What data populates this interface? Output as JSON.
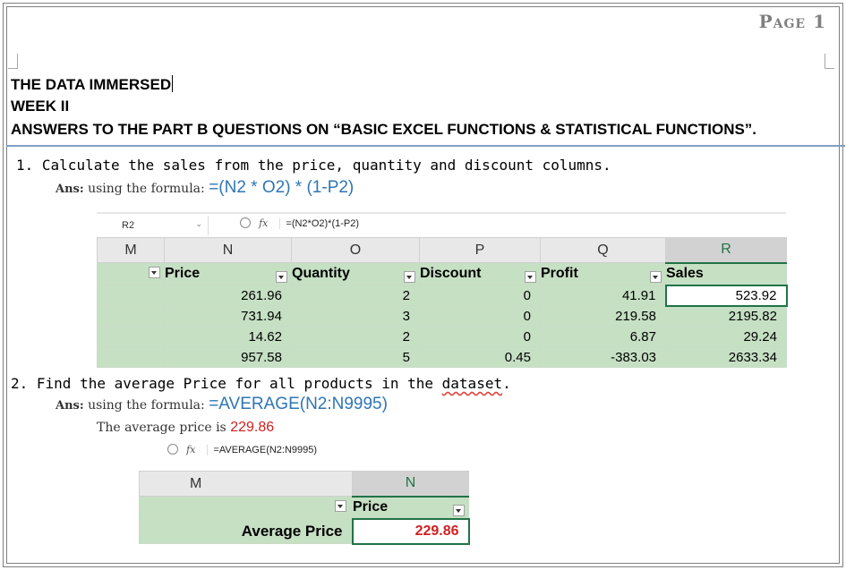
{
  "header": {
    "page_label": "Page 1"
  },
  "title": {
    "line1": "THE DATA IMMERSED",
    "line2": "WEEK II",
    "line3": "ANSWERS TO THE PART B QUESTIONS ON “BASIC EXCEL FUNCTIONS & STATISTICAL FUNCTIONS”."
  },
  "q1": {
    "number": "1.",
    "text": "Calculate the sales from the price, quantity and discount columns.",
    "ans_label": "Ans:",
    "ans_text": "using the formula:",
    "formula": "=(N2 * O2) * (1-P2)",
    "excel": {
      "cell_ref": "R2",
      "formula_bar": "=(N2*O2)*(1-P2)",
      "columns": [
        "M",
        "N",
        "O",
        "P",
        "Q",
        "R"
      ],
      "fields": [
        "Price",
        "Quantity",
        "Discount",
        "Profit",
        "Sales"
      ],
      "rows": [
        [
          "261.96",
          "2",
          "0",
          "41.91",
          "523.92"
        ],
        [
          "731.94",
          "3",
          "0",
          "219.58",
          "2195.82"
        ],
        [
          "14.62",
          "2",
          "0",
          "6.87",
          "29.24"
        ],
        [
          "957.58",
          "5",
          "0.45",
          "-383.03",
          "2633.34"
        ]
      ]
    }
  },
  "q2": {
    "number": "2.",
    "text_before": "Find the average Price for all products in the ",
    "text_underlined": "dataset",
    "text_after": ".",
    "ans_label": "Ans:",
    "ans_text": "using the formula:",
    "formula": "=AVERAGE(N2:N9995)",
    "result_text": "The average price is",
    "result_value": "229.86",
    "excel": {
      "formula_bar": "=AVERAGE(N2:N9995)",
      "columns": [
        "M",
        "N"
      ],
      "field": "Price",
      "row_label": "Average Price",
      "row_value": "229.86"
    }
  },
  "colors": {
    "rule": "#7f9fc4",
    "formula": "#2e75b6",
    "result": "#d02020",
    "table_fill": "#c6e0c4",
    "excel_green": "#217346"
  }
}
